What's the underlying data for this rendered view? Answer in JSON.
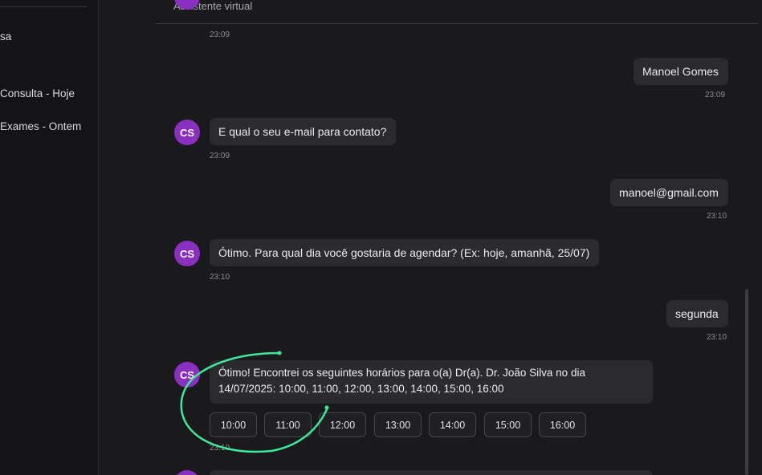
{
  "sidebar": {
    "items": [
      {
        "label": "sa"
      },
      {
        "label": "Consulta - Hoje"
      },
      {
        "label": "Exames - Ontem"
      }
    ]
  },
  "header": {
    "subtitle": "Assistente virtual"
  },
  "messages": [
    {
      "from": "bot",
      "time": "23:09"
    },
    {
      "from": "user",
      "text": "Manoel Gomes",
      "time": "23:09"
    },
    {
      "from": "bot",
      "avatar": "CS",
      "text": "E qual o seu e-mail para contato?",
      "time": "23:09"
    },
    {
      "from": "user",
      "text": "manoel@gmail.com",
      "time": "23:10"
    },
    {
      "from": "bot",
      "avatar": "CS",
      "text": "Ótimo. Para qual dia você gostaria de agendar? (Ex: hoje, amanhã, 25/07)",
      "time": "23:10"
    },
    {
      "from": "user",
      "text": "segunda",
      "time": "23:10"
    },
    {
      "from": "bot",
      "avatar": "CS",
      "line1": "Ótimo! Encontrei os seguintes horários para o(a) Dr(a). Dr. João Silva no dia",
      "line2": "14/07/2025: 10:00, 11:00, 12:00, 13:00, 14:00, 15:00, 16:00",
      "time": "23:10",
      "slots": [
        "10:00",
        "11:00",
        "12:00",
        "13:00",
        "14:00",
        "15:00",
        "16:00"
      ]
    }
  ],
  "colors": {
    "accent_avatar": "#8a2fc0",
    "annotation": "#3ee89a",
    "bubble": "#2a2a2f"
  }
}
